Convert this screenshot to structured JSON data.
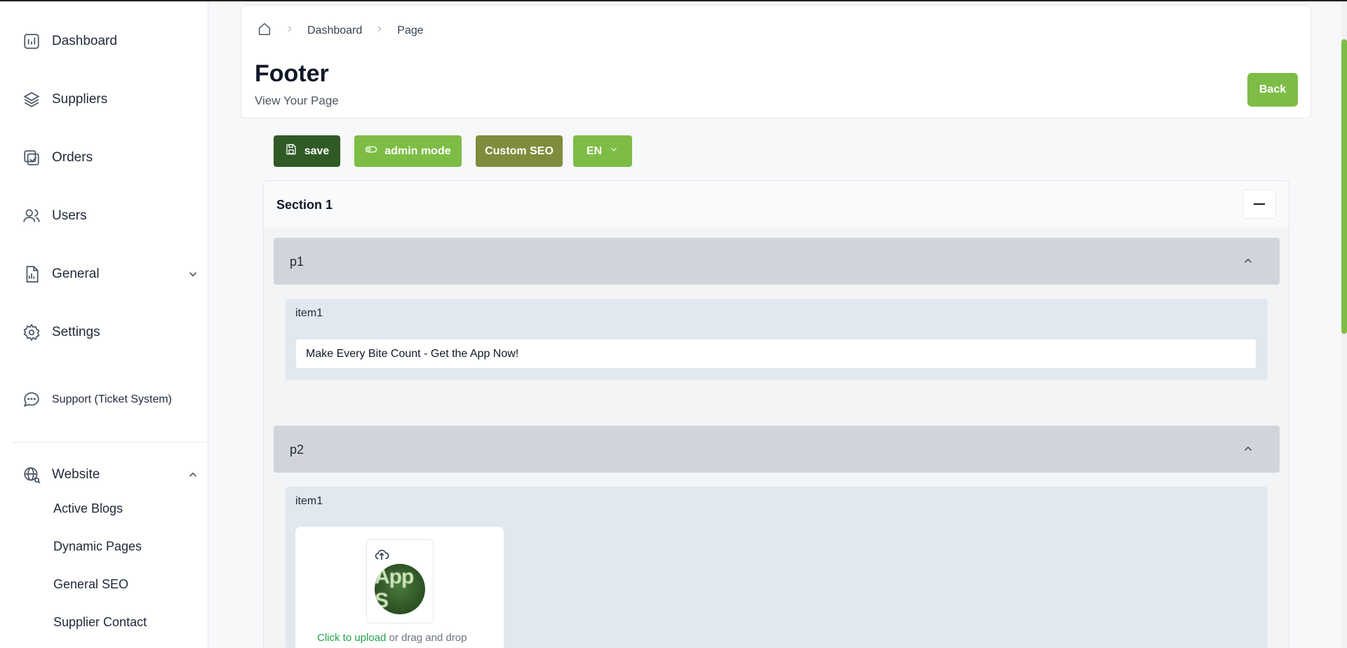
{
  "sidebar": {
    "items": [
      {
        "label": "Dashboard",
        "icon": "chart-bar-icon"
      },
      {
        "label": "Suppliers",
        "icon": "layers-icon"
      },
      {
        "label": "Orders",
        "icon": "order-check-icon"
      },
      {
        "label": "Users",
        "icon": "users-icon"
      },
      {
        "label": "General",
        "icon": "report-icon"
      },
      {
        "label": "Settings",
        "icon": "gear-icon"
      },
      {
        "label": "Support (Ticket System)",
        "icon": "chat-bubble-icon"
      },
      {
        "label": "Website",
        "icon": "globe-icon"
      }
    ],
    "website_sub": [
      "Active Blogs",
      "Dynamic Pages",
      "General SEO",
      "Supplier Contact"
    ]
  },
  "header": {
    "breadcrumb": [
      "Dashboard",
      "Page"
    ],
    "title": "Footer",
    "subtitle": "View Your Page",
    "back_label": "Back"
  },
  "toolbar": {
    "save_label": "save",
    "admin_label": "admin mode",
    "seo_label": "Custom SEO",
    "lang_label": "EN"
  },
  "colors": {
    "accent": "#7dbd45",
    "save_bg": "#2f5a24",
    "seo_bg": "#7f8c3c"
  },
  "section": {
    "title": "Section 1",
    "panels": [
      {
        "label": "p1",
        "item_label": "item1",
        "value": "Make Every Bite Count - Get the App Now!"
      },
      {
        "label": "p2",
        "item_label": "item1",
        "upload_link": "Click to upload",
        "upload_rest": " or drag and drop",
        "image_text": "App S"
      }
    ]
  }
}
